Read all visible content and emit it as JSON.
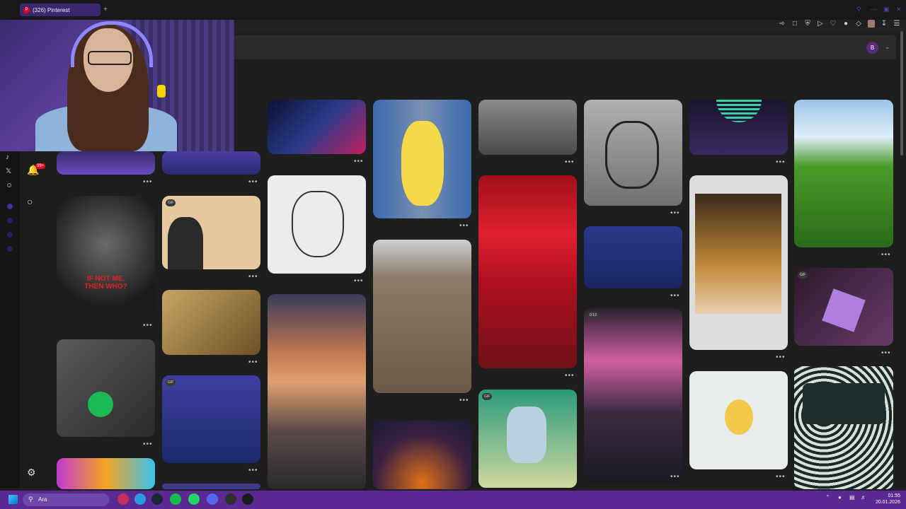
{
  "browser": {
    "tab_title": "(326) Pinterest",
    "new_tab_glyph": "+",
    "favicon_glyph": "P",
    "extension_icons": [
      "pin-icon",
      "bookmark-icon",
      "shield-icon",
      "play-icon",
      "heart-icon",
      "gamepad-icon",
      "puzzle-icon",
      "profile-icon",
      "download-icon",
      "menu-icon"
    ]
  },
  "pinterest": {
    "avatar_letter": "B",
    "notifications_badge": "99+",
    "rail_icons": [
      "tiktok-icon",
      "x-icon",
      "discord-icon"
    ]
  },
  "pins": [
    {
      "id": "pin-red-night",
      "text": "",
      "gif": false
    },
    {
      "id": "pin-cow",
      "text": "",
      "gif": false
    },
    {
      "id": "pin-duck",
      "text": "",
      "gif": false
    },
    {
      "id": "pin-eiffel-homer",
      "text": "",
      "gif": false
    },
    {
      "id": "pin-tattoo-statue",
      "text": "",
      "gif": false
    },
    {
      "id": "pin-bart-sunset",
      "text": "",
      "gif": false
    },
    {
      "id": "pin-grass",
      "text": "",
      "gif": false
    },
    {
      "id": "pin-ifnotme",
      "text": "IF NOT ME,\nTHEN WHO?",
      "gif": false
    },
    {
      "id": "pin-smoke-gif",
      "text": "",
      "gif": true,
      "gif_label": "GIF"
    },
    {
      "id": "pin-creation-cat",
      "text": "",
      "gif": false
    },
    {
      "id": "pin-hollywood",
      "text": "",
      "gif": false
    },
    {
      "id": "pin-leg-tattoo",
      "text": "",
      "gif": false
    },
    {
      "id": "pin-red-ocean",
      "text": "",
      "gif": false
    },
    {
      "id": "pin-bart-room",
      "text": "",
      "gif": false
    },
    {
      "id": "pin-mouse-eiffel",
      "text": "",
      "gif": false
    },
    {
      "id": "pin-hand-gif",
      "text": "",
      "gif": true,
      "gif_label": "GIF"
    },
    {
      "id": "pin-spotify",
      "text": "",
      "gif": false
    },
    {
      "id": "pin-anime-gif",
      "text": "",
      "gif": true,
      "gif_label": "GIF"
    },
    {
      "id": "pin-fire",
      "text": "",
      "gif": false
    },
    {
      "id": "pin-rick",
      "text": "",
      "gif": true,
      "gif_label": "GIF"
    },
    {
      "id": "pin-cherry-car",
      "text": "",
      "gif": false,
      "duration": "0:13"
    },
    {
      "id": "pin-psyduck",
      "text": "",
      "gif": false
    },
    {
      "id": "pin-pattern",
      "text": "",
      "gif": false
    },
    {
      "id": "pin-colorful",
      "text": "",
      "gif": false
    }
  ],
  "more_glyph": "•••",
  "taskbar": {
    "search_placeholder": "Ara",
    "time": "01:55",
    "date": "20.01.2026",
    "apps": [
      "opera-gx-icon",
      "edge-icon",
      "steam-icon",
      "spotify-icon",
      "whatsapp-icon",
      "discord-icon",
      "obs-icon",
      "app-icon"
    ]
  },
  "colors": {
    "accent": "#5a2a92",
    "tab": "#3b2770",
    "pinterest_red": "#e60023",
    "background": "#1e1e1f"
  }
}
